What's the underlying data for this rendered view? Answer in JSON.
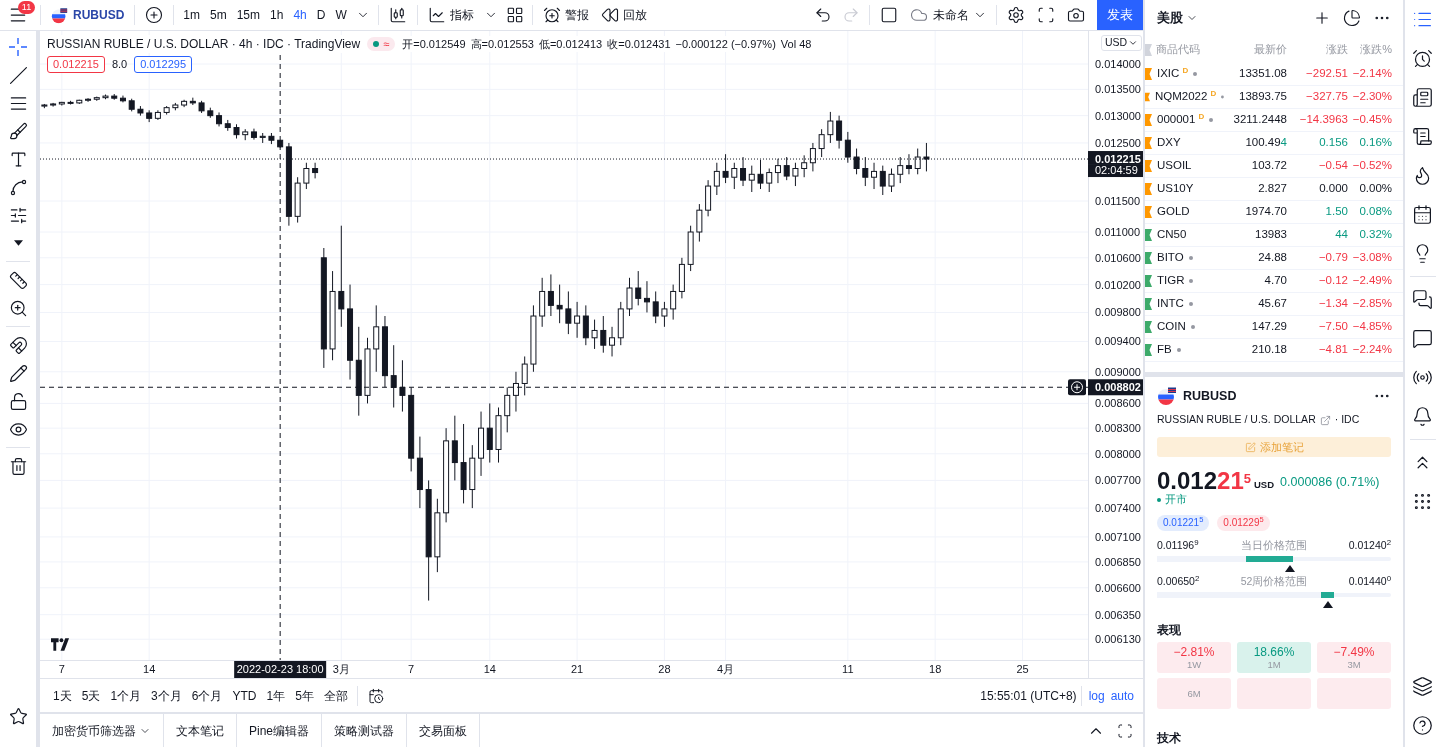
{
  "toolbar": {
    "menu_badge": "11",
    "symbol": "RUBUSD",
    "intervals": [
      {
        "label": "1m",
        "selected": false
      },
      {
        "label": "5m",
        "selected": false
      },
      {
        "label": "15m",
        "selected": false
      },
      {
        "label": "1h",
        "selected": false
      },
      {
        "label": "4h",
        "selected": true
      },
      {
        "label": "D",
        "selected": false
      },
      {
        "label": "W",
        "selected": false
      }
    ],
    "indicators": "指标",
    "alerts": "警报",
    "replay": "回放",
    "history": [
      {
        "kind": "undo",
        "disabled": false
      },
      {
        "kind": "redo",
        "disabled": true
      }
    ],
    "layout_name": "未命名",
    "publish": "发表"
  },
  "drawing_tools": {
    "groups": [
      [
        {
          "kind": "crosshair",
          "selected": true
        },
        {
          "kind": "trend_line",
          "selected": false
        },
        {
          "kind": "horizontal_lines",
          "selected": false
        },
        {
          "kind": "brush",
          "selected": false
        },
        {
          "kind": "text",
          "selected": false
        },
        {
          "kind": "pattern",
          "selected": false
        },
        {
          "kind": "forecast",
          "selected": false
        },
        {
          "kind": "more",
          "selected": false
        }
      ],
      [
        {
          "kind": "ruler",
          "selected": false
        },
        {
          "kind": "zoom",
          "selected": false
        }
      ],
      [
        {
          "kind": "magnet",
          "selected": false
        },
        {
          "kind": "drawing_lock",
          "selected": false
        },
        {
          "kind": "lock",
          "selected": false
        },
        {
          "kind": "visibility",
          "selected": false
        }
      ],
      [
        {
          "kind": "remove",
          "selected": false
        }
      ]
    ],
    "bottom": [
      {
        "kind": "favorites",
        "selected": false
      }
    ]
  },
  "chart": {
    "title": "RUSSIAN RUBLE / U.S. DOLLAR · 4h · IDC · TradingView",
    "market_open": true,
    "status_mark": "≈",
    "ohlc": [
      "开=0.012549",
      "高=0.012553",
      "低=0.012413",
      "收=0.012431",
      "−0.000122 (−0.97%)",
      "Vol 48"
    ],
    "bid": "0.012215",
    "spread": "8.0",
    "ask": "0.012295",
    "currency": "USD",
    "countdown": "02:04:59",
    "chart_data": [
      {
        "type": "candlestick",
        "log": true,
        "grid": true,
        "ylim": [
          0.00595,
          0.01468
        ],
        "yticks": [
          {
            "value": 0.014,
            "label": "0.014000"
          },
          {
            "value": 0.0135,
            "label": "0.013500"
          },
          {
            "value": 0.013,
            "label": "0.013000"
          },
          {
            "value": 0.0125,
            "label": "0.012500"
          },
          {
            "value": 0.0115,
            "label": "0.011500"
          },
          {
            "value": 0.011,
            "label": "0.011000"
          },
          {
            "value": 0.0106,
            "label": "0.010600"
          },
          {
            "value": 0.0102,
            "label": "0.010200"
          },
          {
            "value": 0.0098,
            "label": "0.009800"
          },
          {
            "value": 0.0094,
            "label": "0.009400"
          },
          {
            "value": 0.009,
            "label": "0.009000"
          },
          {
            "value": 0.0086,
            "label": "0.008600"
          },
          {
            "value": 0.0083,
            "label": "0.008300"
          },
          {
            "value": 0.008,
            "label": "0.008000"
          },
          {
            "value": 0.0077,
            "label": "0.007700"
          },
          {
            "value": 0.0074,
            "label": "0.007400"
          },
          {
            "value": 0.0071,
            "label": "0.007100"
          },
          {
            "value": 0.00685,
            "label": "0.006850"
          },
          {
            "value": 0.0066,
            "label": "0.006600"
          },
          {
            "value": 0.00635,
            "label": "0.006350"
          },
          {
            "value": 0.00613,
            "label": "0.006130"
          }
        ],
        "categories": [
          null,
          null,
          "7",
          null,
          null,
          null,
          null,
          null,
          null,
          null,
          null,
          null,
          "14",
          null,
          null,
          null,
          null,
          null,
          null,
          null,
          null,
          null,
          null,
          null,
          null,
          null,
          null,
          "2022-02-23 18:00",
          null,
          null,
          null,
          null,
          null,
          null,
          "3月",
          null,
          null,
          null,
          null,
          null,
          null,
          null,
          "7",
          null,
          null,
          null,
          null,
          null,
          null,
          null,
          null,
          "14",
          null,
          null,
          null,
          null,
          null,
          null,
          null,
          null,
          null,
          "21",
          null,
          null,
          null,
          null,
          null,
          null,
          null,
          null,
          null,
          "28",
          null,
          null,
          null,
          null,
          null,
          null,
          "4月",
          null,
          null,
          null,
          null,
          null,
          null,
          null,
          null,
          null,
          null,
          null,
          null,
          null,
          "11",
          null,
          null,
          null,
          null,
          null,
          null,
          null,
          null,
          null,
          "18",
          null,
          null,
          null,
          null,
          null,
          null,
          null,
          null,
          null,
          "25",
          null,
          null,
          null,
          null,
          null,
          null,
          null
        ],
        "ref_lines": [
          {
            "axis": "y",
            "value": 0.012215,
            "label": "0.012215",
            "line_style": "dotted"
          },
          {
            "axis": "y",
            "value": 0.008802,
            "label": "0.008802",
            "line_style": "dashed"
          },
          {
            "axis": "x",
            "value": "2022-02-23 18:00",
            "line_style": "dashed"
          }
        ],
        "ohlc": [
          [
            0.01318,
            0.01322,
            0.01314,
            0.0132
          ],
          [
            0.0132,
            0.01324,
            0.01317,
            0.01322
          ],
          [
            0.01322,
            0.01326,
            0.01319,
            0.01325
          ],
          [
            0.01325,
            0.01328,
            0.01321,
            0.01324
          ],
          [
            0.01324,
            0.0133,
            0.01322,
            0.01329
          ],
          [
            0.01329,
            0.01333,
            0.01326,
            0.01331
          ],
          [
            0.01331,
            0.01336,
            0.01328,
            0.01334
          ],
          [
            0.01334,
            0.0134,
            0.01331,
            0.01337
          ],
          [
            0.01337,
            0.01341,
            0.0133,
            0.01333
          ],
          [
            0.01333,
            0.01338,
            0.01325,
            0.01328
          ],
          [
            0.01328,
            0.01332,
            0.01308,
            0.01312
          ],
          [
            0.01312,
            0.01318,
            0.013,
            0.01305
          ],
          [
            0.01305,
            0.0131,
            0.01288,
            0.01295
          ],
          [
            0.01295,
            0.0131,
            0.01292,
            0.01306
          ],
          [
            0.01306,
            0.01318,
            0.01302,
            0.01315
          ],
          [
            0.01315,
            0.01324,
            0.0131,
            0.0132
          ],
          [
            0.0132,
            0.0133,
            0.01316,
            0.01327
          ],
          [
            0.01327,
            0.01334,
            0.0132,
            0.01324
          ],
          [
            0.01324,
            0.01328,
            0.01305,
            0.01309
          ],
          [
            0.01309,
            0.01315,
            0.01296,
            0.013
          ],
          [
            0.013,
            0.01306,
            0.0128,
            0.01285
          ],
          [
            0.01285,
            0.01292,
            0.01272,
            0.01278
          ],
          [
            0.01278,
            0.01284,
            0.01258,
            0.01265
          ],
          [
            0.01265,
            0.01275,
            0.01255,
            0.0127
          ],
          [
            0.0127,
            0.01276,
            0.01256,
            0.0126
          ],
          [
            0.0126,
            0.01268,
            0.0125,
            0.01262
          ],
          [
            0.01262,
            0.01268,
            0.01248,
            0.012549
          ],
          [
            0.012549,
            0.012553,
            0.012413,
            0.012431
          ],
          [
            0.01243,
            0.0125,
            0.0111,
            0.01125
          ],
          [
            0.01125,
            0.0119,
            0.01115,
            0.0118
          ],
          [
            0.0118,
            0.01215,
            0.0117,
            0.01205
          ],
          [
            0.01205,
            0.01215,
            0.01188,
            0.01198
          ],
          [
            0.0106,
            0.01075,
            0.00905,
            0.0093
          ],
          [
            0.0093,
            0.0104,
            0.00915,
            0.0101
          ],
          [
            0.0101,
            0.0111,
            0.0096,
            0.00985
          ],
          [
            0.00985,
            0.0102,
            0.0089,
            0.00915
          ],
          [
            0.00915,
            0.0096,
            0.00845,
            0.0087
          ],
          [
            0.0087,
            0.00945,
            0.0086,
            0.0093
          ],
          [
            0.0093,
            0.0099,
            0.009,
            0.0096
          ],
          [
            0.0096,
            0.00975,
            0.0088,
            0.00895
          ],
          [
            0.00895,
            0.00935,
            0.00855,
            0.0088
          ],
          [
            0.0088,
            0.00915,
            0.0085,
            0.0087
          ],
          [
            0.0087,
            0.0088,
            0.0078,
            0.00795
          ],
          [
            0.00795,
            0.0082,
            0.0074,
            0.0076
          ],
          [
            0.0076,
            0.0077,
            0.00648,
            0.0069
          ],
          [
            0.0069,
            0.0075,
            0.00675,
            0.00735
          ],
          [
            0.00735,
            0.0083,
            0.00725,
            0.00815
          ],
          [
            0.00815,
            0.00845,
            0.0077,
            0.0079
          ],
          [
            0.0079,
            0.00835,
            0.00745,
            0.0076
          ],
          [
            0.0076,
            0.0081,
            0.0074,
            0.00795
          ],
          [
            0.00795,
            0.0085,
            0.00775,
            0.0083
          ],
          [
            0.0083,
            0.0086,
            0.0079,
            0.00805
          ],
          [
            0.00805,
            0.00855,
            0.0079,
            0.00845
          ],
          [
            0.00845,
            0.0088,
            0.00825,
            0.0087
          ],
          [
            0.0087,
            0.009,
            0.0085,
            0.00885
          ],
          [
            0.00885,
            0.0092,
            0.0087,
            0.0091
          ],
          [
            0.0091,
            0.0099,
            0.009,
            0.00975
          ],
          [
            0.00975,
            0.0103,
            0.0096,
            0.0101
          ],
          [
            0.0101,
            0.01035,
            0.00975,
            0.0099
          ],
          [
            0.0099,
            0.0102,
            0.00965,
            0.00985
          ],
          [
            0.00985,
            0.0101,
            0.0095,
            0.00965
          ],
          [
            0.00965,
            0.00995,
            0.00945,
            0.00975
          ],
          [
            0.00975,
            0.0099,
            0.00935,
            0.00945
          ],
          [
            0.00945,
            0.0097,
            0.0093,
            0.00955
          ],
          [
            0.00955,
            0.00975,
            0.00925,
            0.00935
          ],
          [
            0.00935,
            0.0096,
            0.0092,
            0.00945
          ],
          [
            0.00945,
            0.00995,
            0.00935,
            0.00985
          ],
          [
            0.00985,
            0.0103,
            0.00975,
            0.01015
          ],
          [
            0.01015,
            0.0104,
            0.0099,
            0.01
          ],
          [
            0.01,
            0.01025,
            0.0098,
            0.00995
          ],
          [
            0.00995,
            0.0101,
            0.00965,
            0.00975
          ],
          [
            0.00975,
            0.00995,
            0.0096,
            0.00985
          ],
          [
            0.00985,
            0.0102,
            0.0097,
            0.0101
          ],
          [
            0.0101,
            0.0106,
            0.01,
            0.0105
          ],
          [
            0.0105,
            0.0111,
            0.0104,
            0.011
          ],
          [
            0.011,
            0.01145,
            0.01085,
            0.01135
          ],
          [
            0.01135,
            0.01185,
            0.01125,
            0.01175
          ],
          [
            0.01175,
            0.01215,
            0.0116,
            0.012
          ],
          [
            0.012,
            0.0123,
            0.0118,
            0.0119
          ],
          [
            0.0119,
            0.01215,
            0.0117,
            0.01205
          ],
          [
            0.01205,
            0.01225,
            0.01175,
            0.01185
          ],
          [
            0.01185,
            0.0121,
            0.01165,
            0.01195
          ],
          [
            0.01195,
            0.0122,
            0.0117,
            0.0118
          ],
          [
            0.0118,
            0.01205,
            0.01165,
            0.01198
          ],
          [
            0.01198,
            0.01222,
            0.0118,
            0.0121
          ],
          [
            0.0121,
            0.01225,
            0.01185,
            0.01192
          ],
          [
            0.01192,
            0.01215,
            0.01175,
            0.01205
          ],
          [
            0.01205,
            0.01228,
            0.0119,
            0.01215
          ],
          [
            0.01215,
            0.0125,
            0.012,
            0.0124
          ],
          [
            0.0124,
            0.01275,
            0.01225,
            0.01265
          ],
          [
            0.01265,
            0.01307,
            0.0125,
            0.0129
          ],
          [
            0.0129,
            0.013,
            0.0124,
            0.01255
          ],
          [
            0.01255,
            0.0127,
            0.01215,
            0.01225
          ],
          [
            0.01225,
            0.0124,
            0.01195,
            0.01205
          ],
          [
            0.01205,
            0.01225,
            0.01175,
            0.0119
          ],
          [
            0.0119,
            0.01215,
            0.0117,
            0.012
          ],
          [
            0.012,
            0.0121,
            0.0116,
            0.01175
          ],
          [
            0.01175,
            0.01205,
            0.01165,
            0.01195
          ],
          [
            0.01195,
            0.01225,
            0.0118,
            0.0121
          ],
          [
            0.0121,
            0.0123,
            0.01195,
            0.01205
          ],
          [
            0.01205,
            0.0124,
            0.01195,
            0.01225
          ],
          [
            0.01225,
            0.0125,
            0.012,
            0.012215
          ],
          null,
          null,
          null,
          null,
          null,
          null,
          null,
          null,
          null,
          null,
          null,
          null,
          null,
          null,
          null,
          null,
          null,
          null
        ]
      }
    ]
  },
  "bottom_bar": {
    "ranges": [
      "1天",
      "5天",
      "1个月",
      "3个月",
      "6个月",
      "YTD",
      "1年",
      "5年",
      "全部"
    ],
    "clock": "15:55:01 (UTC+8)",
    "scale_options": [
      {
        "label": "log",
        "selected": true
      },
      {
        "label": "auto",
        "selected": true
      }
    ]
  },
  "panel_tabs": [
    {
      "label": "加密货币筛选器",
      "menu": true
    },
    {
      "label": "文本笔记",
      "menu": false
    },
    {
      "label": "Pine编辑器",
      "menu": false
    },
    {
      "label": "策略测试器",
      "menu": false
    },
    {
      "label": "交易面板",
      "menu": false
    }
  ],
  "watchlist": {
    "title": "美股",
    "columns": [
      "商品代码",
      "最新价",
      "涨跌",
      "涨跌%"
    ],
    "rows": [
      {
        "symbol": "IXIC$^{D}$",
        "color": "#ff9800",
        "status_dot": true,
        "price": "13351.08",
        "change": "−292.51",
        "change_pct": "−2.14%",
        "falling": true,
        "rising": false
      },
      {
        "symbol": "NQM2022$^{D}$",
        "color": "#ff9800",
        "status_dot": true,
        "price": "13893.75",
        "change": "−327.75",
        "change_pct": "−2.30%",
        "falling": true,
        "rising": false
      },
      {
        "symbol": "000001$^{D}$",
        "color": "#ff9800",
        "status_dot": true,
        "price": "3211.2448",
        "change": "−14.3963",
        "change_pct": "−0.45%",
        "falling": true,
        "rising": false
      },
      {
        "symbol": "DXY",
        "color": "#ff9800",
        "status_dot": false,
        "price": "100.49",
        "price_tail": "4",
        "change": "0.156",
        "change_pct": "0.16%",
        "falling": false,
        "rising": true
      },
      {
        "symbol": "USOIL",
        "color": "#ff9800",
        "status_dot": false,
        "price": "103.72",
        "change": "−0.54",
        "change_pct": "−0.52%",
        "falling": true,
        "rising": false
      },
      {
        "symbol": "US10Y",
        "color": "#ff9800",
        "status_dot": false,
        "price": "2.827",
        "change": "0.000",
        "change_pct": "0.00%",
        "falling": false,
        "rising": false
      },
      {
        "symbol": "GOLD",
        "color": "#ff9800",
        "status_dot": false,
        "price": "1974.70",
        "change": "1.50",
        "change_pct": "0.08%",
        "falling": false,
        "rising": true
      },
      {
        "symbol": "CN50",
        "color": "#3daa6a",
        "status_dot": false,
        "price": "13983",
        "change": "44",
        "change_pct": "0.32%",
        "falling": false,
        "rising": true
      },
      {
        "symbol": "BITO",
        "color": "#3daa6a",
        "status_dot": true,
        "price": "24.88",
        "change": "−0.79",
        "change_pct": "−3.08%",
        "falling": true,
        "rising": false
      },
      {
        "symbol": "TIGR",
        "color": "#3daa6a",
        "status_dot": true,
        "price": "4.70",
        "change": "−0.12",
        "change_pct": "−2.49%",
        "falling": true,
        "rising": false
      },
      {
        "symbol": "INTC",
        "color": "#3daa6a",
        "status_dot": true,
        "price": "45.67",
        "change": "−1.34",
        "change_pct": "−2.85%",
        "falling": true,
        "rising": false
      },
      {
        "symbol": "COIN",
        "color": "#3daa6a",
        "status_dot": true,
        "price": "147.29",
        "change": "−7.50",
        "change_pct": "−4.85%",
        "falling": true,
        "rising": false
      },
      {
        "symbol": "FB",
        "color": "#3daa6a",
        "status_dot": true,
        "price": "210.18",
        "change": "−4.81",
        "change_pct": "−2.24%",
        "falling": true,
        "rising": false
      }
    ]
  },
  "details": {
    "symbol": "RUBUSD",
    "name": "RUSSIAN RUBLE / U.S. DOLLAR",
    "exchange": "· IDC",
    "note_button": "添加笔记",
    "price": {
      "lead": "0.012",
      "changed": "21",
      "pip": "5",
      "falling": true
    },
    "currency": "USD",
    "change": "0.000086 (0.71%)",
    "change_rising": true,
    "session": "开市",
    "market_open": true,
    "bid": "0.01221$^{5}$",
    "ask": "0.01229$^{5}$",
    "day_range": {
      "low": "0.01196$^{9}$",
      "label": "当日价格范围",
      "high": "0.01240$^{2}$",
      "level": 0.57,
      "fill_end": {
        "level": 0.58
      },
      "fill_start": {
        "level": 0.38
      }
    },
    "week52_range": {
      "low": "0.00650$^{2}$",
      "label": "52周价格范围",
      "high": "0.01440$^{0}$",
      "level": 0.73,
      "fill_end": {
        "level": 0.755
      },
      "fill_start": {
        "level": 0.7
      }
    },
    "performance": {
      "title": "表现",
      "cards": [
        {
          "value": "−2.81%",
          "period": "1W",
          "falling": true
        },
        {
          "value": "18.66%",
          "period": "1M",
          "falling": false
        },
        {
          "value": "−7.49%",
          "period": "3M",
          "falling": true
        },
        {
          "period": "6M",
          "falling": true
        },
        {
          "falling": true
        },
        {
          "falling": true
        }
      ]
    },
    "technicals_title": "技术"
  },
  "sidebar": {
    "groups": [
      [
        {
          "kind": "watchlist",
          "selected": true
        },
        {
          "kind": "alarm",
          "selected": false
        },
        {
          "kind": "news",
          "selected": false
        },
        {
          "kind": "ideas",
          "selected": false
        },
        {
          "kind": "hotlist",
          "selected": false
        },
        {
          "kind": "calendar",
          "selected": false
        },
        {
          "kind": "tips",
          "selected": false
        }
      ],
      [
        {
          "kind": "chats",
          "selected": false
        },
        {
          "kind": "chat",
          "selected": false
        },
        {
          "kind": "streams",
          "selected": false
        },
        {
          "kind": "notifications",
          "selected": false
        }
      ],
      [
        {
          "kind": "signals",
          "selected": false
        },
        {
          "kind": "dom",
          "selected": false
        }
      ]
    ],
    "bottom": [
      {
        "kind": "layers",
        "selected": false
      },
      {
        "kind": "help",
        "selected": false
      }
    ]
  }
}
